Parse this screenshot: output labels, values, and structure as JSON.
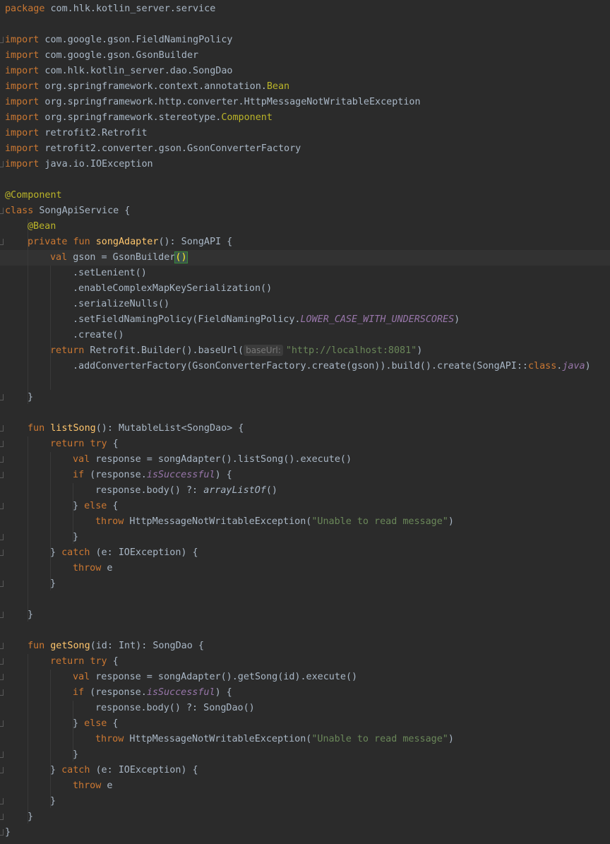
{
  "editor": {
    "theme_colors": {
      "background": "#2b2b2b",
      "keyword": "#cc7832",
      "plain": "#a9b7c6",
      "function": "#ffc66d",
      "annotation": "#bbb529",
      "string": "#6a8759",
      "property": "#9876aa"
    },
    "code": {
      "package_kw": "package",
      "package_name": " com.hlk.kotlin_server.service",
      "import_kw": "import",
      "imports": {
        "i1": " com.google.gson.FieldNamingPolicy",
        "i2": " com.google.gson.GsonBuilder",
        "i3": " com.hlk.kotlin_server.dao.SongDao",
        "i4a": " org.springframework.context.annotation.",
        "i4b": "Bean",
        "i5": " org.springframework.http.converter.HttpMessageNotWritableException",
        "i6a": " org.springframework.stereotype.",
        "i6b": "Component",
        "i7": " retrofit2.Retrofit",
        "i8": " retrofit2.converter.gson.GsonConverterFactory",
        "i9": " java.io.IOException"
      },
      "annotation_component": "@Component",
      "class_kw": "class",
      "class_rest": " SongApiService {",
      "annotation_bean": "@Bean",
      "private_kw": "private",
      "fun_kw": "fun",
      "val_kw": "val",
      "return_kw": "return",
      "try_kw": "try",
      "if_kw": "if",
      "else_kw": "else",
      "throw_kw": "throw",
      "catch_kw": "catch",
      "songAdapter_name": "songAdapter",
      "songAdapter_sig": "(): SongAPI {",
      "gson_decl": " gson = GsonBuilder",
      "paren_open": "(",
      "paren_close": ")",
      "set_lenient": ".setLenient()",
      "enable_complex": ".enableComplexMapKeySerialization()",
      "serialize_nulls": ".serializeNulls()",
      "set_naming_a": ".setFieldNamingPolicy(FieldNamingPolicy.",
      "set_naming_b": "LOWER_CASE_WITH_UNDERSCORES",
      "set_naming_c": ")",
      "create": ".create()",
      "retrofit_builder": " Retrofit.Builder().baseUrl(",
      "hint_base_url": "baseUrl:",
      "base_url_string": "\"http://localhost:8081\"",
      "add_converter": ".addConverterFactory(GsonConverterFactory.create(gson)).build().create(SongAPI::",
      "class_kw2": "class",
      "dot": ".",
      "java_prop": "java",
      "close_paren": ")",
      "close_brace": "}",
      "listSong_name": "listSong",
      "listSong_sig": "(): MutableList<SongDao> {",
      "try_open": " {",
      "response_list": " response = songAdapter().listSong().execute()",
      "if_open": " (response.",
      "is_successful": "isSuccessful",
      "if_close": ") {",
      "body_elvis": "response.body() ?: ",
      "array_list_of": "arrayListOf",
      "empty_parens": "()",
      "else_open_pre": "} ",
      "else_open_post": " {",
      "throw_rest": " HttpMessageNotWritableException(",
      "unable_string": "\"Unable to read message\"",
      "catch_pre": "} ",
      "catch_post": " (e: IOException) {",
      "throw_e": " e",
      "getSong_name": "getSong",
      "getSong_sig": "(id: Int): SongDao {",
      "response_get": " response = songAdapter().getSong(id).execute()",
      "body_songdao": "response.body() ?: SongDao()"
    }
  }
}
